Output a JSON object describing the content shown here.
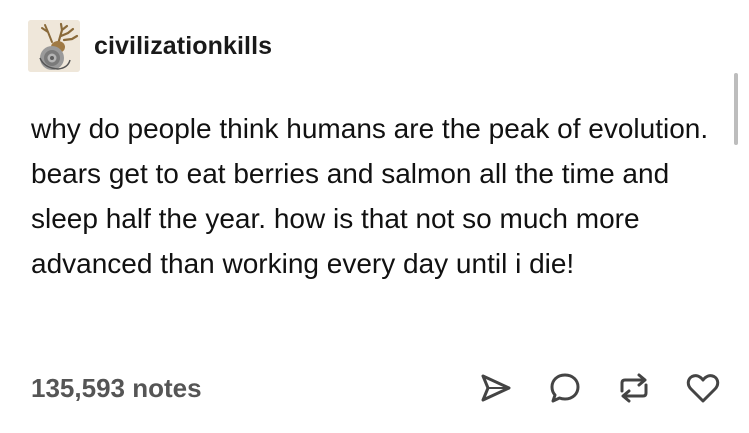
{
  "post": {
    "username": "civilizationkills",
    "avatar_icon": "elk-seal-avatar-icon",
    "body": "why do people think humans are the peak of evolution. bears get to eat berries and salmon all the time and sleep half the year. how is that not so much more advanced than working every day until i die!",
    "notes": "135,593 notes"
  },
  "actions": {
    "share_icon": "share-icon",
    "reply_icon": "reply-icon",
    "reblog_icon": "reblog-icon",
    "like_icon": "heart-icon"
  },
  "colors": {
    "text": "#111111",
    "notes": "#555555",
    "icons": "#444444",
    "scrollbar": "#bdbdbd"
  }
}
